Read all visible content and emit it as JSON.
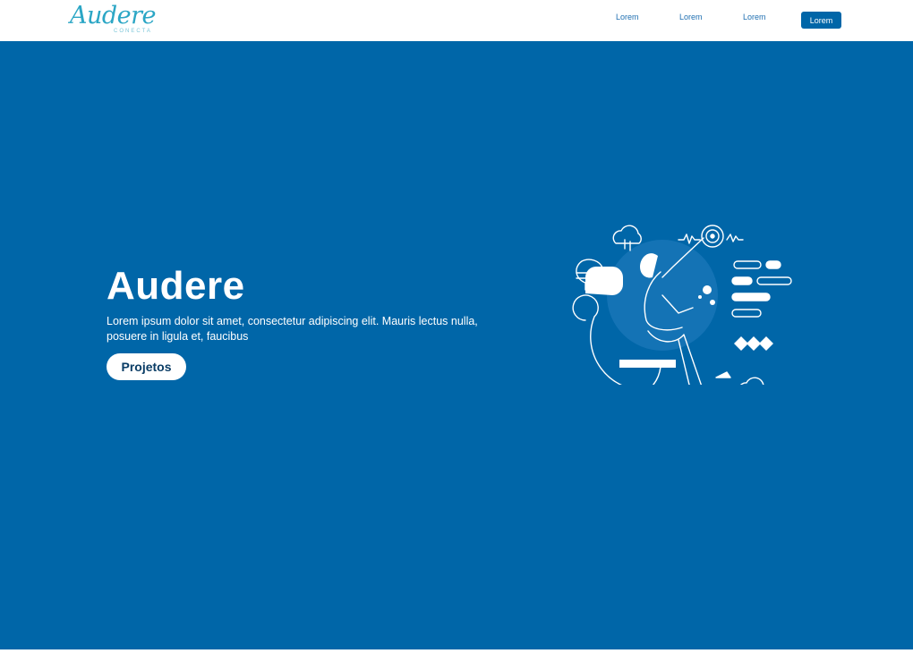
{
  "brand": {
    "name": "Audere",
    "subtitle": "CONECTA",
    "color": "#2ba6c5"
  },
  "nav": {
    "links": [
      "Lorem",
      "Lorem",
      "Lorem"
    ],
    "cta_label": "Lorem"
  },
  "hero": {
    "title": "Audere",
    "description": "Lorem ipsum dolor sit amet, consectetur adipiscing elit. Mauris lectus nulla, posuere in ligula et, faucibus",
    "button_label": "Projetos",
    "background": "#0066a8",
    "illustration": "woman-with-phone-and-chat-icons"
  }
}
